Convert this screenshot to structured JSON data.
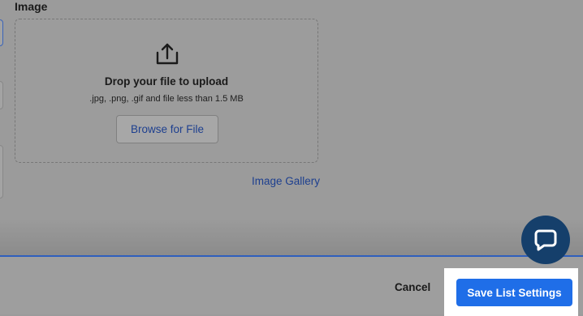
{
  "image_section": {
    "label": "Image",
    "dropzone": {
      "icon": "upload-icon",
      "title": "Drop your file to upload",
      "hint": ".jpg, .png, .gif and file less than 1.5 MB",
      "browse_label": "Browse for File"
    },
    "gallery_link": "Image Gallery"
  },
  "footer": {
    "cancel_label": "Cancel",
    "save_label": "Save List Settings"
  },
  "chat": {
    "icon": "chat-bubble-icon"
  },
  "colors": {
    "primary": "#1f6ee8",
    "link": "#1d3f8f",
    "chat": "#153f6b",
    "overlay": "#9b9b9b"
  }
}
